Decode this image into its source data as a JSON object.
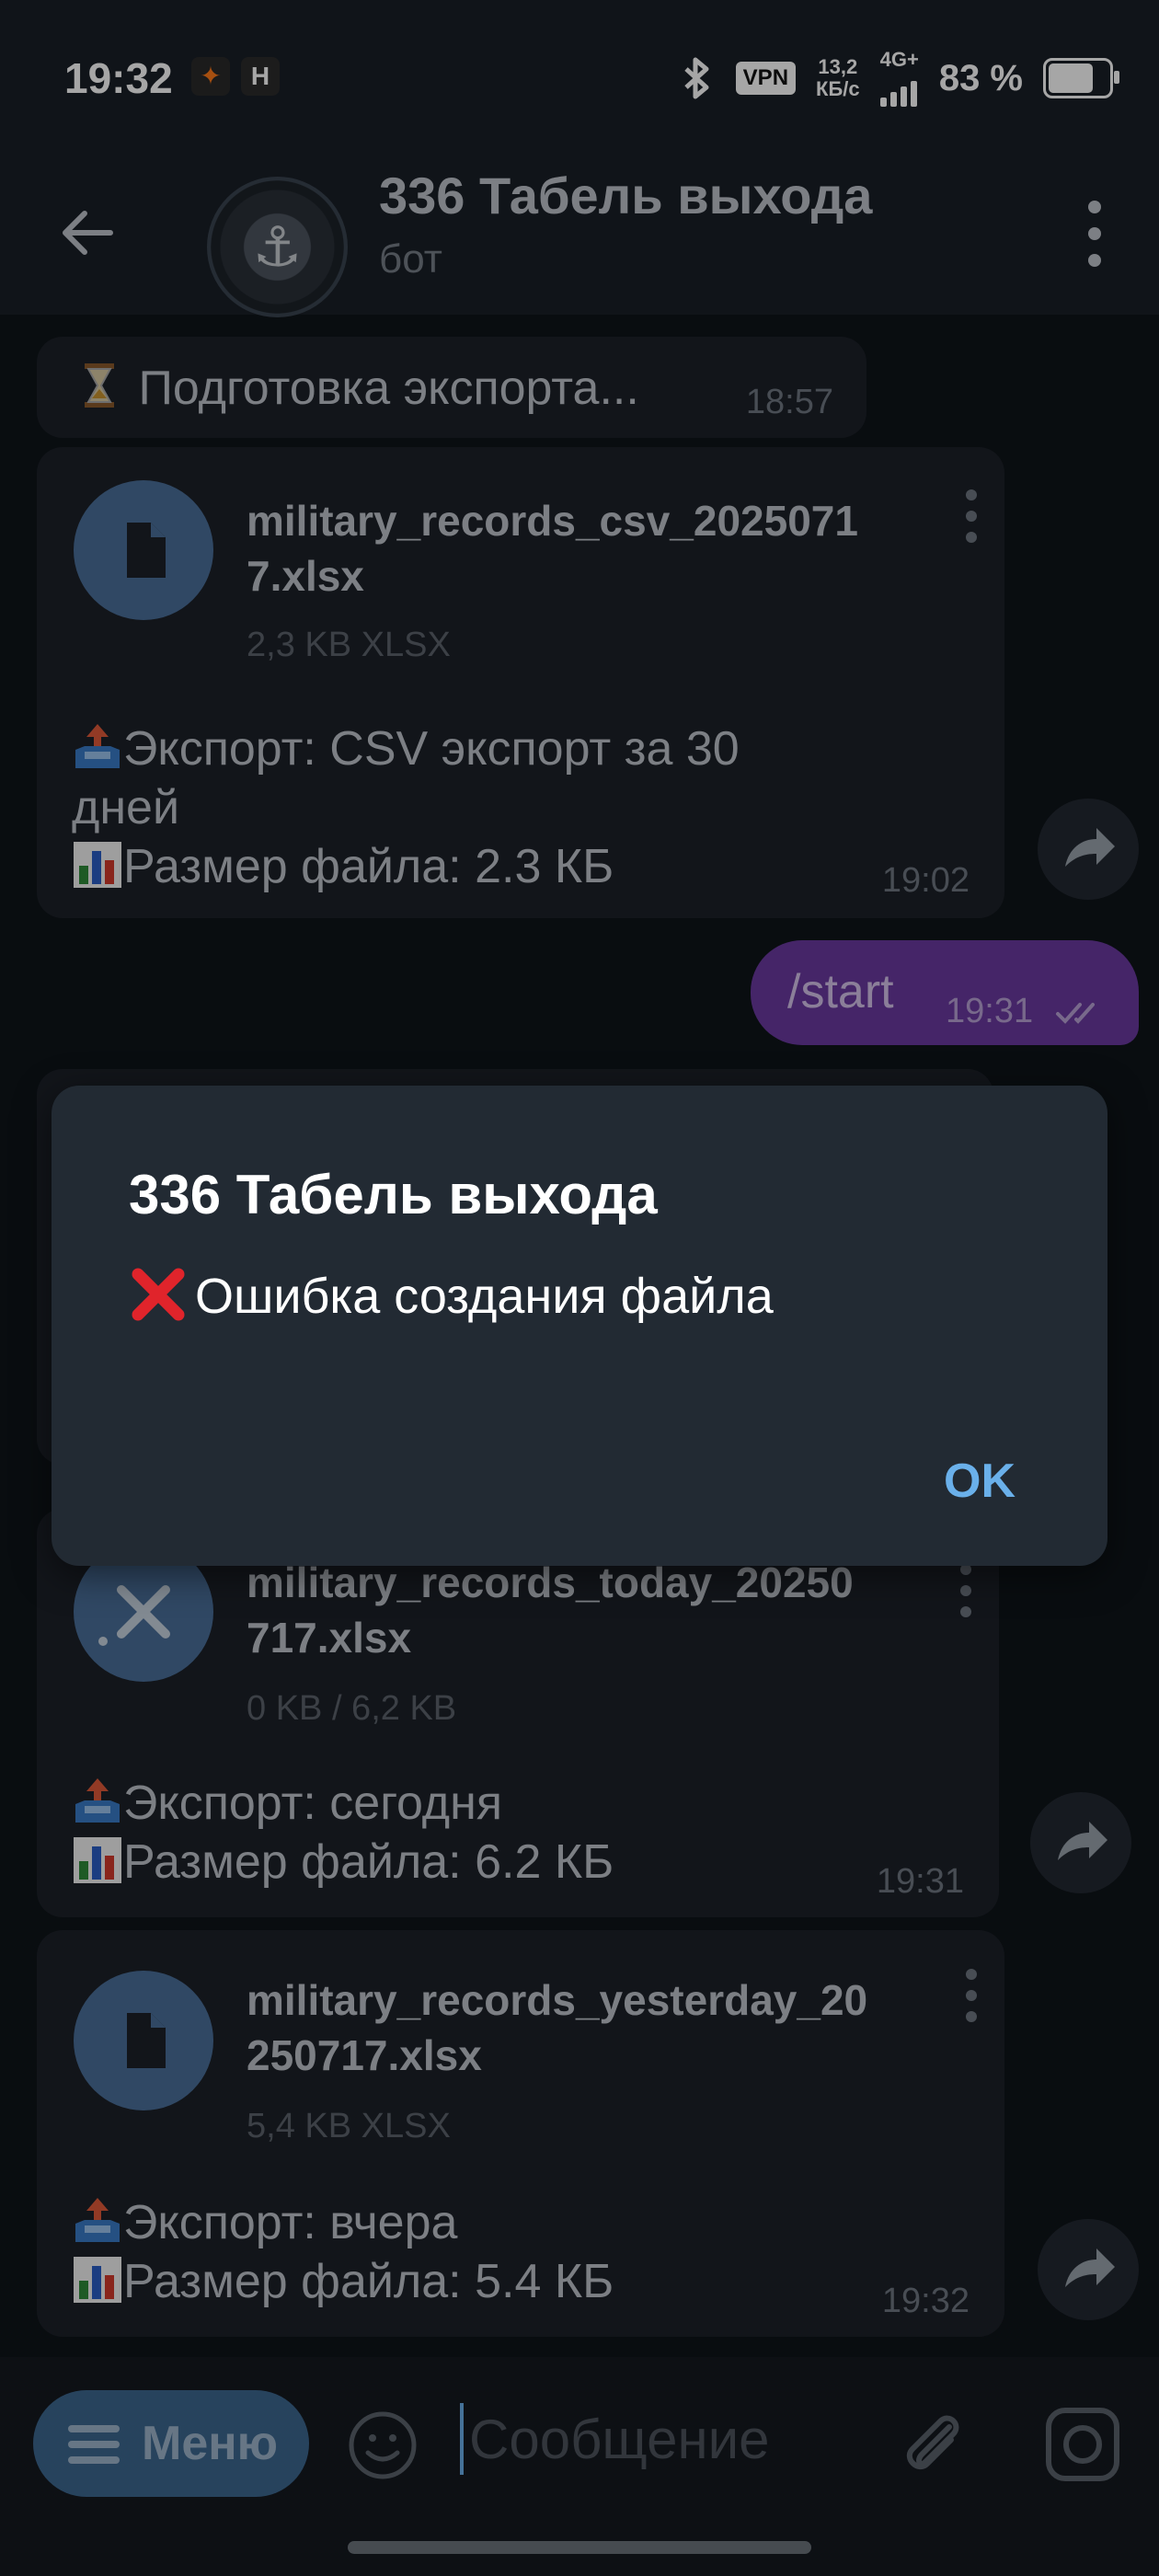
{
  "status_bar": {
    "time": "19:32",
    "vpn_label": "VPN",
    "net_speed_value": "13,2",
    "net_speed_unit": "КБ/с",
    "network_type": "4G+",
    "battery_percent": "83 %",
    "battery_level": 0.83
  },
  "header": {
    "title": "336 Табель выхода",
    "subtitle": "бот"
  },
  "messages": [
    {
      "type": "text",
      "text": "Подготовка экспорта...",
      "time": "18:57"
    },
    {
      "type": "file",
      "file_name_line1": "military_records_csv_2025071",
      "file_name_line2": "7.xlsx",
      "file_size": "2,3 KB XLSX",
      "caption_line1": "Экспорт: CSV экспорт за 30",
      "caption_line2": "дней",
      "caption_line3": "Размер файла: 2.3 КБ",
      "time": "19:02"
    },
    {
      "type": "outgoing",
      "text": "/start",
      "time": "19:31"
    },
    {
      "type": "file",
      "file_name_line1": "military_records_today_20250",
      "file_name_line2": "717.xlsx",
      "file_size": "0 KB / 6,2 KB",
      "caption_line1": "Экспорт: сегодня",
      "caption_line2": "Размер файла: 6.2 КБ",
      "time": "19:31"
    },
    {
      "type": "file",
      "file_name_line1": "military_records_yesterday_20",
      "file_name_line2": "250717.xlsx",
      "file_size": "5,4 KB XLSX",
      "caption_line1": "Экспорт: вчера",
      "caption_line2": "Размер файла: 5.4 КБ",
      "time": "19:32"
    }
  ],
  "dialog": {
    "title": "336 Табель выхода",
    "message": "Ошибка создания файла",
    "ok_label": "OK"
  },
  "input_bar": {
    "menu_label": "Меню",
    "placeholder": "Сообщение"
  },
  "colors": {
    "accent": "#6ab0ea",
    "outgoing_bubble": "#6a3aa0",
    "error": "#e0242b"
  }
}
